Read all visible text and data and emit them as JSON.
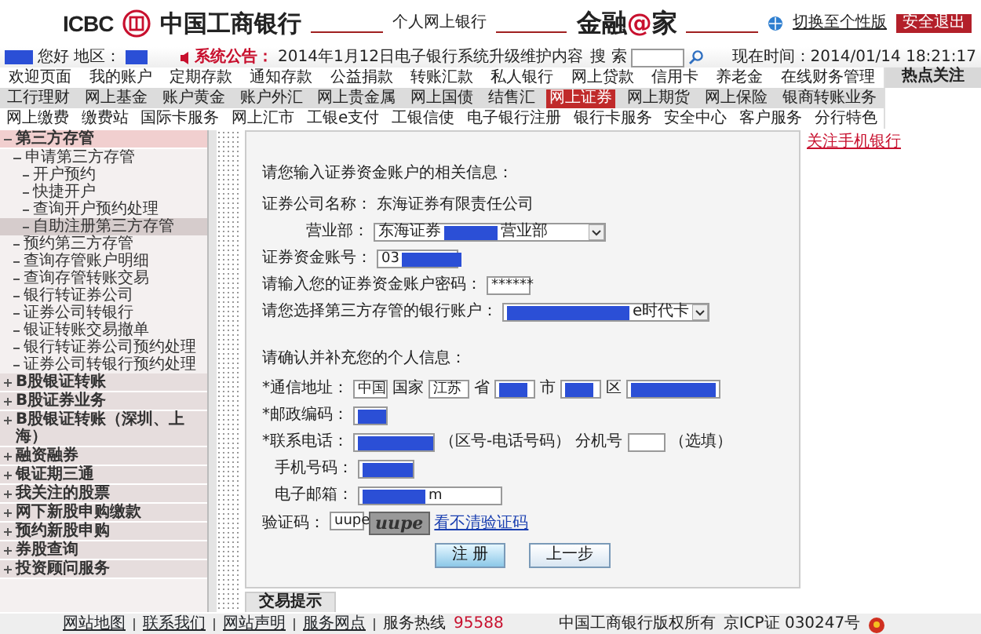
{
  "header": {
    "logo_text": "ICBC",
    "bank_name": "中国工商银行",
    "subtitle": "个人网上银行",
    "slogan_parts": [
      {
        "text": "金融",
        "accent": false
      },
      {
        "text": "@",
        "accent": true
      },
      {
        "text": "家",
        "accent": false
      }
    ],
    "switch_link": "切换至个性版",
    "logout_button": "安全退出"
  },
  "info_bar": {
    "greeting": "您好",
    "region_label": "地区：",
    "announcement_label": "系统公告：",
    "announcement": "2014年1月12日电子银行系统升级维护内容",
    "search_label": "搜 索",
    "time": "现在时间：2014/01/14 18:21:17"
  },
  "nav_rows": [
    {
      "items": [
        {
          "label": "欢迎页面",
          "selected": false
        },
        {
          "label": "我的账户",
          "selected": false
        },
        {
          "label": "定期存款",
          "selected": false
        },
        {
          "label": "通知存款",
          "selected": false
        },
        {
          "label": "公益捐款",
          "selected": false
        },
        {
          "label": "转账汇款",
          "selected": false
        },
        {
          "label": "私人银行",
          "selected": false
        },
        {
          "label": "网上贷款",
          "selected": false
        },
        {
          "label": "信用卡",
          "selected": false
        },
        {
          "label": "养老金",
          "selected": false
        },
        {
          "label": "在线财务管理",
          "selected": false
        }
      ]
    },
    {
      "items": [
        {
          "label": "工行理财",
          "selected": false
        },
        {
          "label": "网上基金",
          "selected": false
        },
        {
          "label": "账户黄金",
          "selected": false
        },
        {
          "label": "账户外汇",
          "selected": false
        },
        {
          "label": "网上贵金属",
          "selected": false
        },
        {
          "label": "网上国债",
          "selected": false
        },
        {
          "label": "结售汇",
          "selected": false
        },
        {
          "label": "网上证券",
          "selected": true
        },
        {
          "label": "网上期货",
          "selected": false
        },
        {
          "label": "网上保险",
          "selected": false
        },
        {
          "label": "银商转账业务",
          "selected": false
        }
      ]
    },
    {
      "items": [
        {
          "label": "网上缴费",
          "selected": false
        },
        {
          "label": "缴费站",
          "selected": false
        },
        {
          "label": "国际卡服务",
          "selected": false
        },
        {
          "label": "网上汇市",
          "selected": false
        },
        {
          "label": "工银e支付",
          "selected": false
        },
        {
          "label": "工银信使",
          "selected": false
        },
        {
          "label": "电子银行注册",
          "selected": false
        },
        {
          "label": "银行卡服务",
          "selected": false
        },
        {
          "label": "安全中心",
          "selected": false
        },
        {
          "label": "客户服务",
          "selected": false
        },
        {
          "label": "分行特色",
          "selected": false
        }
      ]
    }
  ],
  "hot_panel": {
    "title": "热点关注",
    "links": [
      "关注手机银行"
    ]
  },
  "sidebar": {
    "items": [
      {
        "label": "第三方存管",
        "expanded": true,
        "selected": false,
        "children": [
          {
            "label": "申请第三方存管",
            "expanded": true,
            "selected": false,
            "children": [
              {
                "label": "开户预约",
                "selected": false
              },
              {
                "label": "快捷开户",
                "selected": false
              },
              {
                "label": "查询开户预约处理",
                "selected": false
              },
              {
                "label": "自助注册第三方存管",
                "selected": true
              }
            ]
          },
          {
            "label": "预约第三方存管",
            "selected": false
          },
          {
            "label": "查询存管账户明细",
            "selected": false
          },
          {
            "label": "查询存管转账交易",
            "selected": false
          },
          {
            "label": "银行转证券公司",
            "selected": false
          },
          {
            "label": "证券公司转银行",
            "selected": false
          },
          {
            "label": "银证转账交易撤单",
            "selected": false
          },
          {
            "label": "银行转证券公司预约处理",
            "selected": false
          },
          {
            "label": "证券公司转银行预约处理",
            "selected": false
          }
        ]
      },
      {
        "label": "B股银证转账",
        "expanded": false,
        "selected": false
      },
      {
        "label": "B股证券业务",
        "expanded": false,
        "selected": false
      },
      {
        "label": "B股银证转账（深圳、上海）",
        "expanded": false,
        "selected": false
      },
      {
        "label": "融资融券",
        "expanded": false,
        "selected": false
      },
      {
        "label": "银证期三通",
        "expanded": false,
        "selected": false
      },
      {
        "label": "我关注的股票",
        "expanded": false,
        "selected": false
      },
      {
        "label": "网下新股申购缴款",
        "expanded": false,
        "selected": false
      },
      {
        "label": "预约新股申购",
        "expanded": false,
        "selected": false
      },
      {
        "label": "券股查询",
        "expanded": false,
        "selected": false
      },
      {
        "label": "投资顾问服务",
        "expanded": false,
        "selected": false
      }
    ]
  },
  "form": {
    "section1_title": "请您输入证券资金账户的相关信息：",
    "company_label": "证券公司名称：",
    "company_name": "东海证券有限责任公司",
    "branch": {
      "label": "营业部：",
      "prefix": "东海证券",
      "redacted": true,
      "suffix": "营业部"
    },
    "account": {
      "label": "证券资金账号：",
      "prefix": "03",
      "redacted": true
    },
    "password": {
      "label": "请输入您的证券资金账户密码：",
      "value": "******"
    },
    "bank_account": {
      "label": "请您选择第三方存管的银行账户：",
      "redacted": true,
      "suffix": "e时代卡"
    },
    "section2_title": "请确认并补充您的个人信息：",
    "address": {
      "label": "*通信地址：",
      "country": "中国",
      "country_unit": "国家",
      "province": "江苏",
      "province_unit": "省",
      "city_redacted": true,
      "city_unit": "市",
      "district_unit": "区",
      "detail_redacted": true
    },
    "postcode": {
      "label": "*邮政编码：",
      "redacted": true
    },
    "phone": {
      "label": "*联系电话：",
      "redacted": true,
      "hint": "（区号-电话号码）",
      "ext_label": "分机号",
      "ext_hint": "（选填）"
    },
    "mobile": {
      "label": "手机号码：",
      "redacted": true
    },
    "email": {
      "label": "电子邮箱：",
      "redacted": true,
      "suffix": "m"
    },
    "captcha": {
      "label": "验证码：",
      "value": "uupe",
      "image_text": "uupe",
      "refresh_link": "看不清验证码"
    },
    "buttons": [
      "注 册",
      "上一步"
    ],
    "bottom_tab": "交易提示"
  },
  "footer": {
    "links": [
      "网站地图",
      "联系我们",
      "网站声明",
      "服务网点"
    ],
    "hotline_label": "服务热线",
    "hotline": "95588",
    "copyright": "中国工商银行版权所有",
    "icp": "京ICP证 030247号"
  }
}
